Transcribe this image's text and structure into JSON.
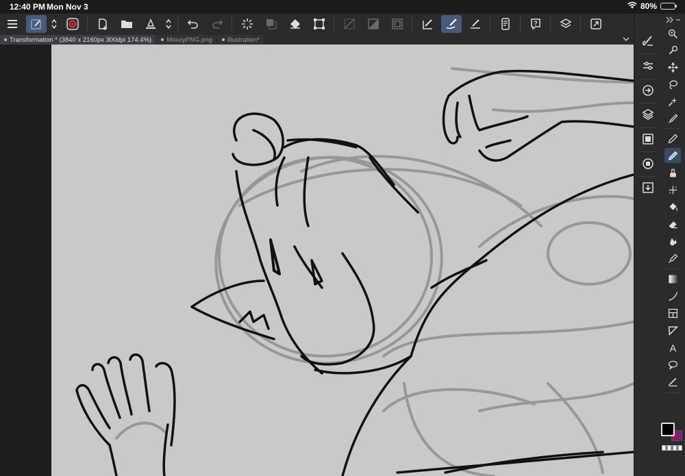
{
  "statusbar": {
    "time": "12:40 PM",
    "date": "Mon Nov 3",
    "battery_percent": "80%",
    "battery_level": 0.8
  },
  "toolbar": {
    "icons": [
      "menu-icon",
      "brush-icon",
      "up-down-arrows-icon",
      "record-icon",
      "new-document-icon",
      "open-folder-icon",
      "save-icon",
      "up-down-arrows-icon",
      "undo-icon",
      "redo-icon",
      "loading-icon",
      "fill-icon",
      "transform-icon",
      "selection-icon",
      "clear-icon",
      "invert-icon",
      "rectangle-icon",
      "pen-check-icon",
      "pen-icon",
      "ruler-icon",
      "smartphone-icon",
      "help-icon",
      "layers-icon",
      "fullscreen-icon"
    ]
  },
  "tabs": [
    {
      "label": "Transformation * (3840 x 2160px 300dpi 174.4%)",
      "active": true
    },
    {
      "label": "MoxxyPNG.png",
      "active": false
    },
    {
      "label": "Illustration*",
      "active": false
    }
  ],
  "right_panel": {
    "icons": [
      "brush-settings-icon",
      "sliders-icon",
      "navigator-icon",
      "layers-icon",
      "frames-icon",
      "material-icon",
      "download-icon"
    ]
  },
  "tools": {
    "icons": [
      "zoom-icon",
      "lasso-icon",
      "move-icon",
      "selection-icon",
      "magic-wand-icon",
      "eyedropper-icon",
      "pen-icon",
      "pencil-icon",
      "brush-icon",
      "airbrush-icon",
      "fill-icon",
      "eraser-icon",
      "blend-icon",
      "figure-icon",
      "gradient-icon",
      "curve-icon",
      "frame-icon",
      "ruler-icon",
      "text-icon",
      "speech-bubble-icon",
      "correction-icon"
    ]
  },
  "colors": {
    "main": "#000000",
    "sub": "#8a1d6b",
    "accent": "#4a5a78",
    "canvas": "#c9c9c9"
  }
}
